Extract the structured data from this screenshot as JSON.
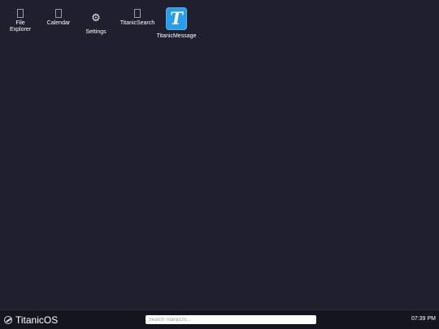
{
  "desktop": {
    "icons": [
      {
        "label_line1": "File",
        "label_line2": "Explorer",
        "icon": "file-explorer-icon"
      },
      {
        "label": "Calendar",
        "icon": "calendar-icon"
      },
      {
        "label": "Settings",
        "icon": "gear-icon",
        "glyph": "⚙"
      },
      {
        "label": "TitanicSearch",
        "icon": "titanic-search-icon"
      },
      {
        "label": "TitanicMessage",
        "icon": "titanic-message-icon",
        "tile_letter": "T",
        "tile_color": "#2a9de8"
      }
    ]
  },
  "taskbar": {
    "brand": "TitanicOS",
    "search_placeholder": "Search TitanicOS...",
    "clock": "07:39 PM"
  }
}
